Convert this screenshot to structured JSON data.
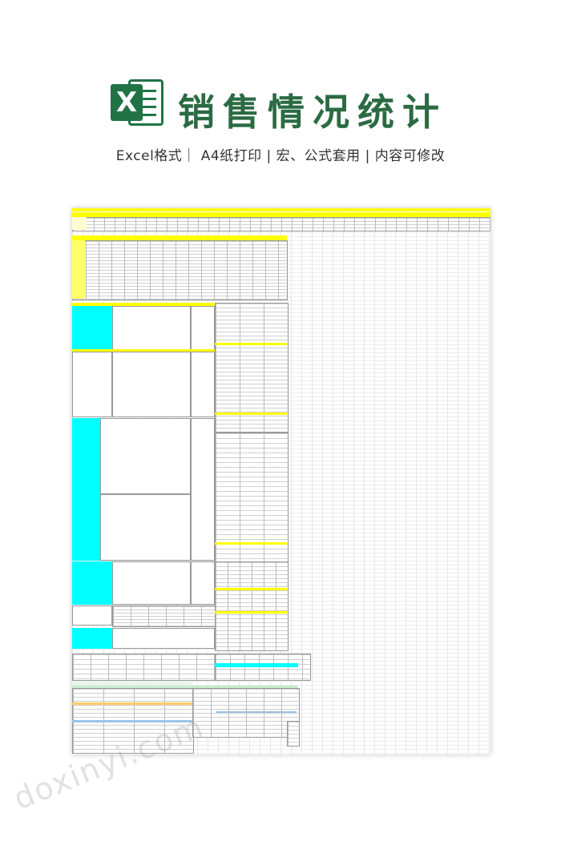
{
  "header": {
    "icon_letter": "X",
    "title": "销售情况统计",
    "subtitle": "Excel格式｜ A4纸打印 | 宏、公式套用 | 内容可修改"
  },
  "colors": {
    "brand_green": "#217346",
    "title_green": "#2b6b43",
    "highlight_yellow": "#ffff00",
    "highlight_cyan": "#00ffff"
  },
  "watermark": "doxinyi.com"
}
